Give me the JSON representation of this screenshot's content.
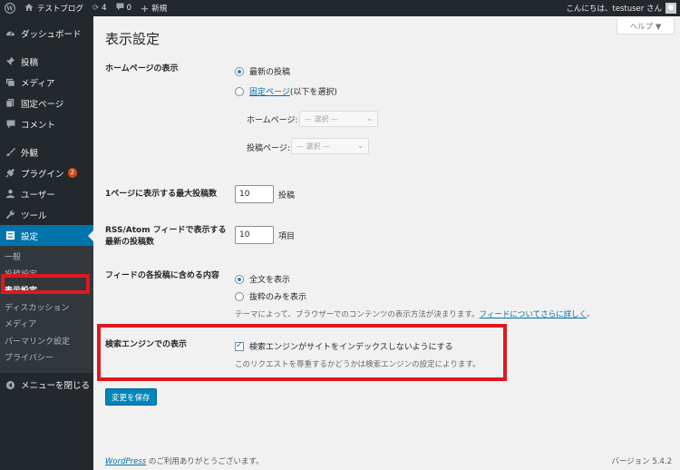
{
  "adminbar": {
    "site_name": "テストブログ",
    "updates_count": "4",
    "comments_count": "0",
    "new_label": "新規",
    "greeting": "こんにちは、testuser さん"
  },
  "sidebar": {
    "dashboard": "ダッシュボード",
    "posts": "投稿",
    "media": "メディア",
    "pages": "固定ページ",
    "comments": "コメント",
    "appearance": "外観",
    "plugins": "プラグイン",
    "plugins_badge": "2",
    "users": "ユーザー",
    "tools": "ツール",
    "settings": "設定",
    "submenu": [
      "一般",
      "投稿設定",
      "表示設定",
      "ディスカッション",
      "メディア",
      "パーマリンク設定",
      "プライバシー"
    ],
    "collapse": "メニューを閉じる"
  },
  "main": {
    "help_label": "ヘルプ ▼",
    "title": "表示設定",
    "homepage": {
      "label": "ホームページの表示",
      "option_latest": "最新の投稿",
      "option_static_link": "固定ページ",
      "option_static_suffix": " (以下を選択)",
      "homepage_label": "ホームページ:",
      "homepage_select": "— 選択 —",
      "postspage_label": "投稿ページ:",
      "postspage_select": "— 選択 —"
    },
    "posts_per_page": {
      "label": "1ページに表示する最大投稿数",
      "value": "10",
      "unit": "投稿"
    },
    "feed_count": {
      "label_line1": "RSS/Atom フィードで表示する",
      "label_line2": "最新の投稿数",
      "value": "10",
      "unit": "項目"
    },
    "feed_content": {
      "label": "フィードの各投稿に含める内容",
      "option_full": "全文を表示",
      "option_summary": "抜粋のみを表示",
      "desc_prefix": "テーマによって、ブラウザーでのコンテンツの表示方法が決まります。",
      "desc_link": "フィードについてさらに詳しく",
      "desc_suffix": "。"
    },
    "search_visibility": {
      "label": "検索エンジンでの表示",
      "checkbox_label": "検索エンジンがサイトをインデックスしないようにする",
      "desc": "このリクエストを尊重するかどうかは検索エンジンの設定によります。"
    },
    "save_button": "変更を保存"
  },
  "footer": {
    "wp_link": "WordPress",
    "thanks": " のご利用ありがとうございます。",
    "version": "バージョン 5.4.2"
  },
  "colors": {
    "adminbar_bg": "#23282d",
    "accent": "#0073aa",
    "highlight_box": "#e0181e"
  }
}
